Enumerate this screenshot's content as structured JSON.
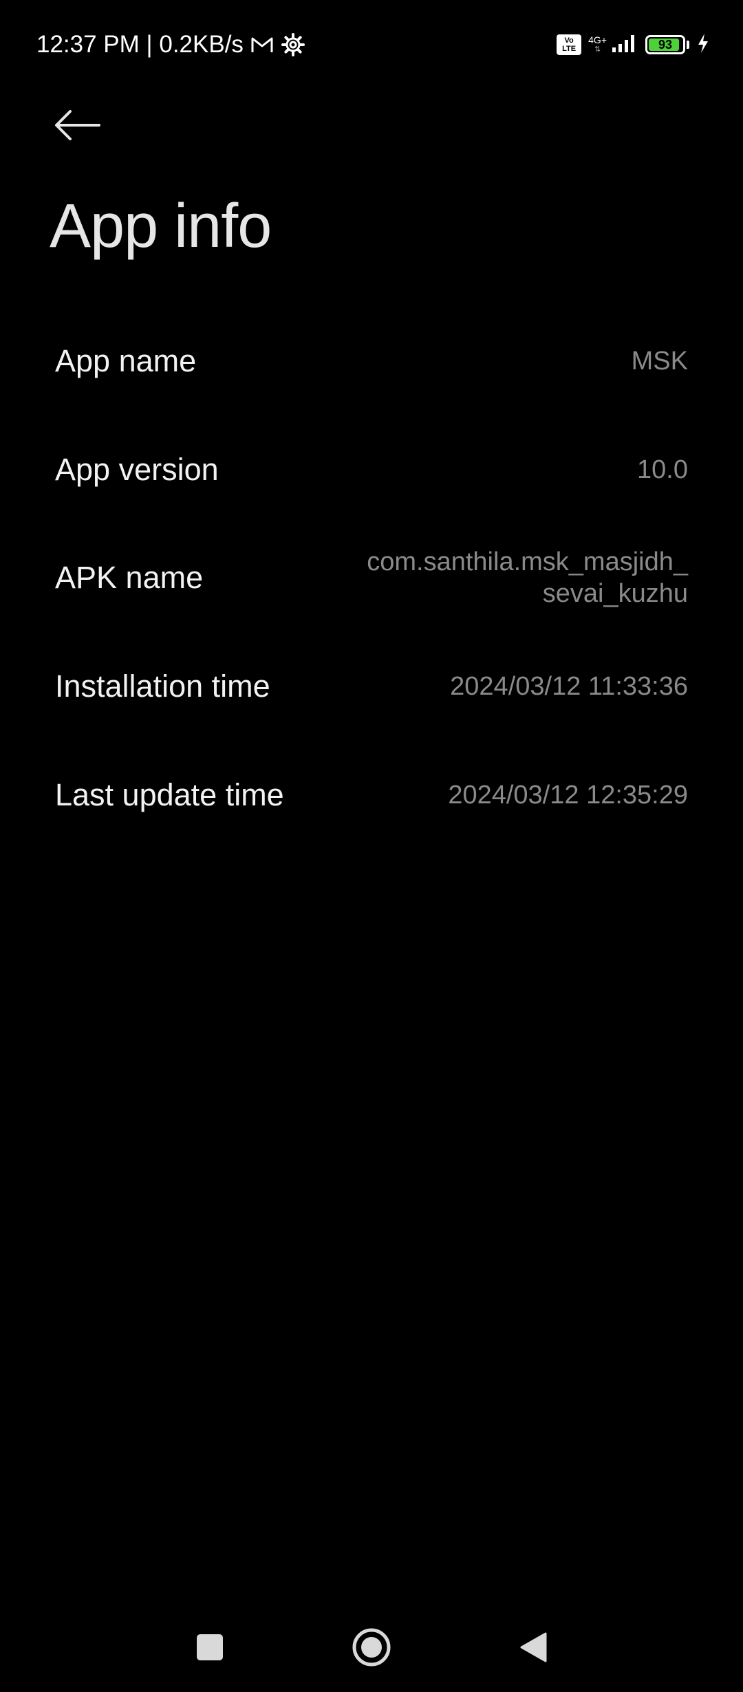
{
  "status_bar": {
    "time_speed": "12:37 PM | 0.2KB/s",
    "volte_line1": "Vo",
    "volte_line2": "LTE",
    "network_type": "4G+",
    "battery_level": "93",
    "battery_fraction": 0.93,
    "battery_color": "#4cd137"
  },
  "header": {
    "back_icon": "arrow-left-icon",
    "title": "App info"
  },
  "info": [
    {
      "label": "App name",
      "value": "MSK"
    },
    {
      "label": "App version",
      "value": "10.0"
    },
    {
      "label": "APK name",
      "value": "com.santhila.msk_masjidh_sevai_kuzhu"
    },
    {
      "label": "Installation time",
      "value": "2024/03/12 11:33:36"
    },
    {
      "label": "Last update time",
      "value": "2024/03/12 12:35:29"
    }
  ],
  "nav_bar": {
    "recents_icon": "square-icon",
    "home_icon": "circle-icon",
    "back_icon": "triangle-back-icon"
  }
}
